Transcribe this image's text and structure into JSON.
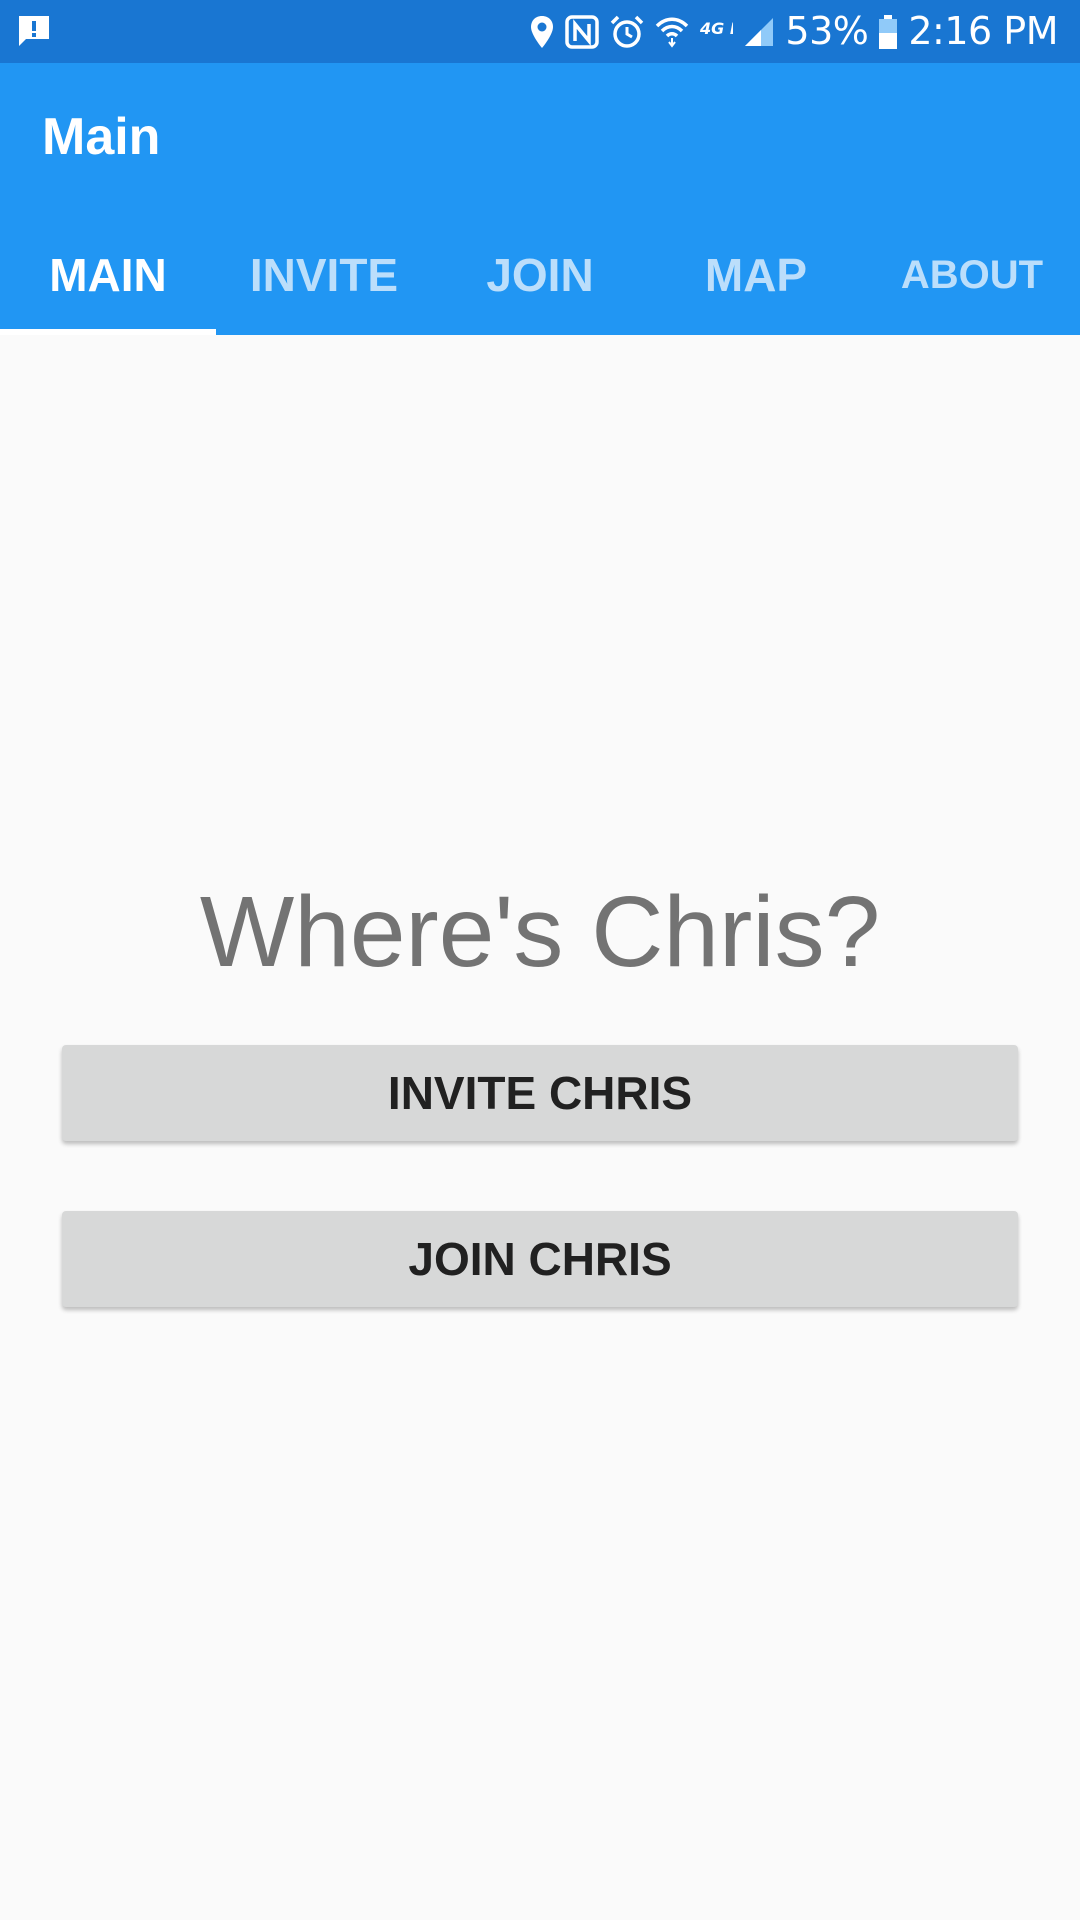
{
  "status_bar": {
    "battery_percent": "53%",
    "time": "2:16 PM",
    "network_label": "4G LTE",
    "left_icons": [
      "alert-notification-icon"
    ],
    "right_icons": [
      "location-icon",
      "nfc-icon",
      "alarm-icon",
      "wifi-icon",
      "lte-icon",
      "signal-icon",
      "battery-icon"
    ]
  },
  "app_bar": {
    "title": "Main",
    "tabs": [
      {
        "label": "MAIN",
        "active": true
      },
      {
        "label": "INVITE",
        "active": false
      },
      {
        "label": "JOIN",
        "active": false
      },
      {
        "label": "MAP",
        "active": false
      },
      {
        "label": "ABOUT",
        "active": false
      }
    ]
  },
  "main": {
    "headline": "Where's Chris?",
    "invite_button_label": "INVITE CHRIS",
    "join_button_label": "JOIN CHRIS"
  },
  "colors": {
    "status_bar": "#1976d2",
    "app_bar": "#2196f3",
    "tab_inactive_text": "#bbdefb",
    "background": "#fafafa",
    "button": "#d7d8d8",
    "headline_text": "#737373"
  }
}
